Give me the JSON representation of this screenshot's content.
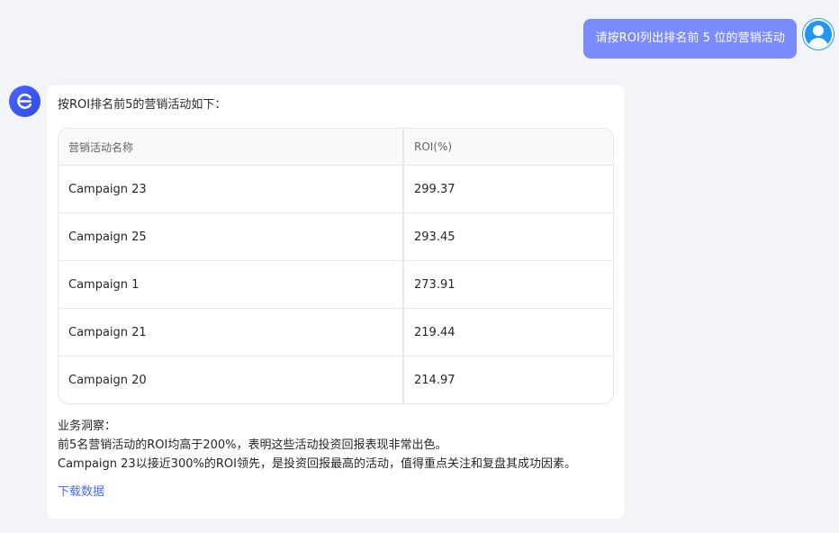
{
  "user_message": {
    "text": "请按ROI列出排名前 5 位的营销活动"
  },
  "assistant": {
    "intro": "按ROI排名前5的营销活动如下：",
    "table": {
      "headers": [
        "营销活动名称",
        "ROI(%)"
      ],
      "rows": [
        [
          "Campaign 23",
          "299.37"
        ],
        [
          "Campaign 25",
          "293.45"
        ],
        [
          "Campaign 1",
          "273.91"
        ],
        [
          "Campaign 21",
          "219.44"
        ],
        [
          "Campaign 20",
          "214.97"
        ]
      ]
    },
    "insights": {
      "title": "业务洞察：",
      "lines": [
        "前5名营销活动的ROI均高于200%，表明这些活动投资回报表现非常出色。",
        "Campaign 23以接近300%的ROI领先，是投资回报最高的活动，值得重点关注和复盘其成功因素。"
      ]
    },
    "download_label": "下载数据"
  },
  "icons": {
    "user_avatar": "user-avatar-icon",
    "bot_avatar": "assistant-logo-icon"
  },
  "colors": {
    "user_bubble": "#7a8cff",
    "bot_avatar": "#3d5afe",
    "link": "#4a6cf7",
    "page_bg": "#f3f4f7"
  }
}
